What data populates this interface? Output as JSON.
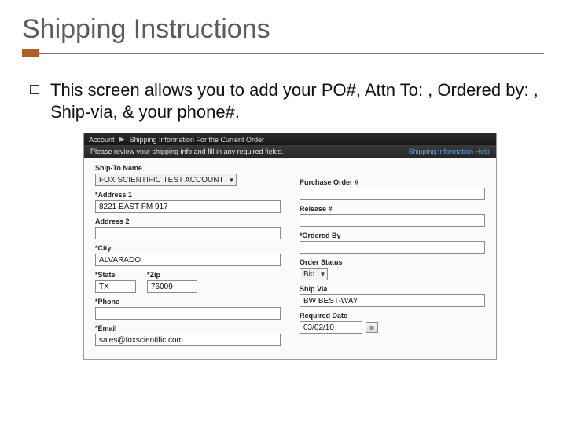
{
  "slide": {
    "title": "Shipping Instructions",
    "bullet_text": "This screen allows you to add your PO#, Attn To: , Ordered by: , Ship-via, & your phone#."
  },
  "app": {
    "breadcrumb_item1": "Account",
    "breadcrumb_sep": "▶",
    "breadcrumb_item2": "Shipping Information For the Current Order",
    "subbar_text": "Please review your shipping info and fill in any required fields.",
    "help_link": "Shipping Information Help"
  },
  "form": {
    "left": {
      "ship_to_label": "Ship-To Name",
      "ship_to_value": "FOX SCIENTIFIC TEST ACCOUNT",
      "address1_label": "*Address 1",
      "address1_value": "8221 EAST FM 917",
      "address2_label": "Address 2",
      "address2_value": "",
      "city_label": "*City",
      "city_value": "ALVARADO",
      "state_label": "*State",
      "state_value": "TX",
      "zip_label": "*Zip",
      "zip_value": "76009",
      "phone_label": "*Phone",
      "phone_value": "",
      "email_label": "*Email",
      "email_value": "sales@foxscientific.com"
    },
    "right": {
      "po_label": "Purchase Order #",
      "po_value": "",
      "release_label": "Release #",
      "release_value": "",
      "ordered_by_label": "*Ordered By",
      "ordered_by_value": "",
      "order_status_label": "Order Status",
      "order_status_value": "Bid",
      "ship_via_label": "Ship Via",
      "ship_via_value": "BW BEST-WAY",
      "required_date_label": "Required Date",
      "required_date_value": "03/02/10"
    }
  }
}
